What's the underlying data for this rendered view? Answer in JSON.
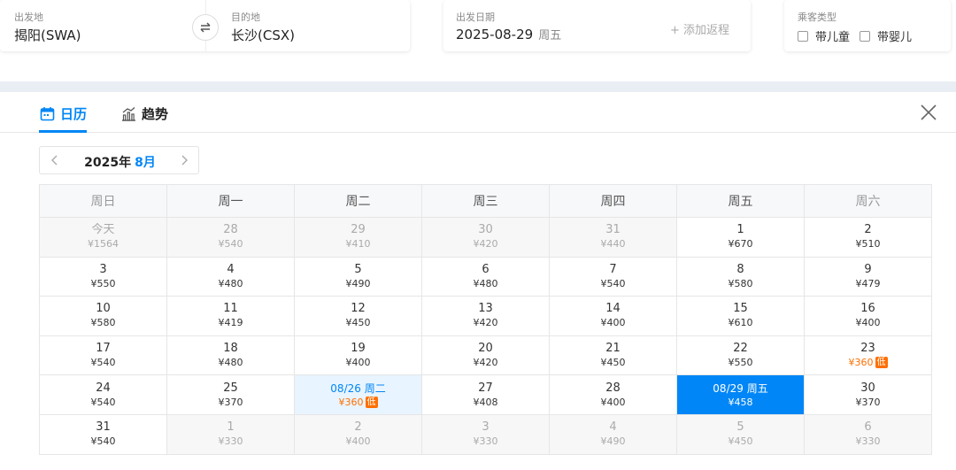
{
  "search": {
    "departure_label": "出发地",
    "departure_value": "揭阳(SWA)",
    "arrival_label": "目的地",
    "arrival_value": "长沙(CSX)",
    "date_label": "出发日期",
    "date_value": "2025-08-29",
    "date_weekday": "周五",
    "add_return": "+ 添加返程",
    "pax_label": "乘客类型",
    "pax_child": "带儿童",
    "pax_infant": "带婴儿"
  },
  "tabs": [
    {
      "label": "日历",
      "icon": "calendar-icon",
      "active": true
    },
    {
      "label": "趋势",
      "icon": "chart-icon",
      "active": false
    }
  ],
  "month_nav": {
    "year": "2025年",
    "month": "8月"
  },
  "weekdays": [
    "周日",
    "周一",
    "周二",
    "周三",
    "周四",
    "周五",
    "周六"
  ],
  "low_badge": "低",
  "colors": {
    "accent": "#0086f6",
    "low_price": "#ff6f00"
  },
  "calendar": [
    [
      {
        "day": "今天",
        "price": "¥1564",
        "state": "past"
      },
      {
        "day": "28",
        "price": "¥540",
        "state": "past"
      },
      {
        "day": "29",
        "price": "¥410",
        "state": "past"
      },
      {
        "day": "30",
        "price": "¥420",
        "state": "past"
      },
      {
        "day": "31",
        "price": "¥440",
        "state": "past"
      },
      {
        "day": "1",
        "price": "¥670",
        "state": "normal"
      },
      {
        "day": "2",
        "price": "¥510",
        "state": "normal"
      }
    ],
    [
      {
        "day": "3",
        "price": "¥550",
        "state": "normal"
      },
      {
        "day": "4",
        "price": "¥480",
        "state": "normal"
      },
      {
        "day": "5",
        "price": "¥490",
        "state": "normal"
      },
      {
        "day": "6",
        "price": "¥480",
        "state": "normal"
      },
      {
        "day": "7",
        "price": "¥540",
        "state": "normal"
      },
      {
        "day": "8",
        "price": "¥580",
        "state": "normal"
      },
      {
        "day": "9",
        "price": "¥479",
        "state": "normal"
      }
    ],
    [
      {
        "day": "10",
        "price": "¥580",
        "state": "normal"
      },
      {
        "day": "11",
        "price": "¥419",
        "state": "normal"
      },
      {
        "day": "12",
        "price": "¥450",
        "state": "normal"
      },
      {
        "day": "13",
        "price": "¥420",
        "state": "normal"
      },
      {
        "day": "14",
        "price": "¥400",
        "state": "normal"
      },
      {
        "day": "15",
        "price": "¥610",
        "state": "normal"
      },
      {
        "day": "16",
        "price": "¥400",
        "state": "normal"
      }
    ],
    [
      {
        "day": "17",
        "price": "¥540",
        "state": "normal"
      },
      {
        "day": "18",
        "price": "¥480",
        "state": "normal"
      },
      {
        "day": "19",
        "price": "¥400",
        "state": "normal"
      },
      {
        "day": "20",
        "price": "¥420",
        "state": "normal"
      },
      {
        "day": "21",
        "price": "¥450",
        "state": "normal"
      },
      {
        "day": "22",
        "price": "¥550",
        "state": "normal"
      },
      {
        "day": "23",
        "price": "¥360",
        "state": "low"
      }
    ],
    [
      {
        "day": "24",
        "price": "¥540",
        "state": "normal"
      },
      {
        "day": "25",
        "price": "¥370",
        "state": "normal"
      },
      {
        "day": "08/26 周二",
        "price": "¥360",
        "state": "sel-return low"
      },
      {
        "day": "27",
        "price": "¥408",
        "state": "normal"
      },
      {
        "day": "28",
        "price": "¥400",
        "state": "normal"
      },
      {
        "day": "08/29 周五",
        "price": "¥458",
        "state": "sel-depart"
      },
      {
        "day": "30",
        "price": "¥370",
        "state": "normal"
      }
    ],
    [
      {
        "day": "31",
        "price": "¥540",
        "state": "normal"
      },
      {
        "day": "1",
        "price": "¥330",
        "state": "past"
      },
      {
        "day": "2",
        "price": "¥400",
        "state": "past"
      },
      {
        "day": "3",
        "price": "¥330",
        "state": "past"
      },
      {
        "day": "4",
        "price": "¥490",
        "state": "past"
      },
      {
        "day": "5",
        "price": "¥450",
        "state": "past"
      },
      {
        "day": "6",
        "price": "¥330",
        "state": "past"
      }
    ]
  ]
}
